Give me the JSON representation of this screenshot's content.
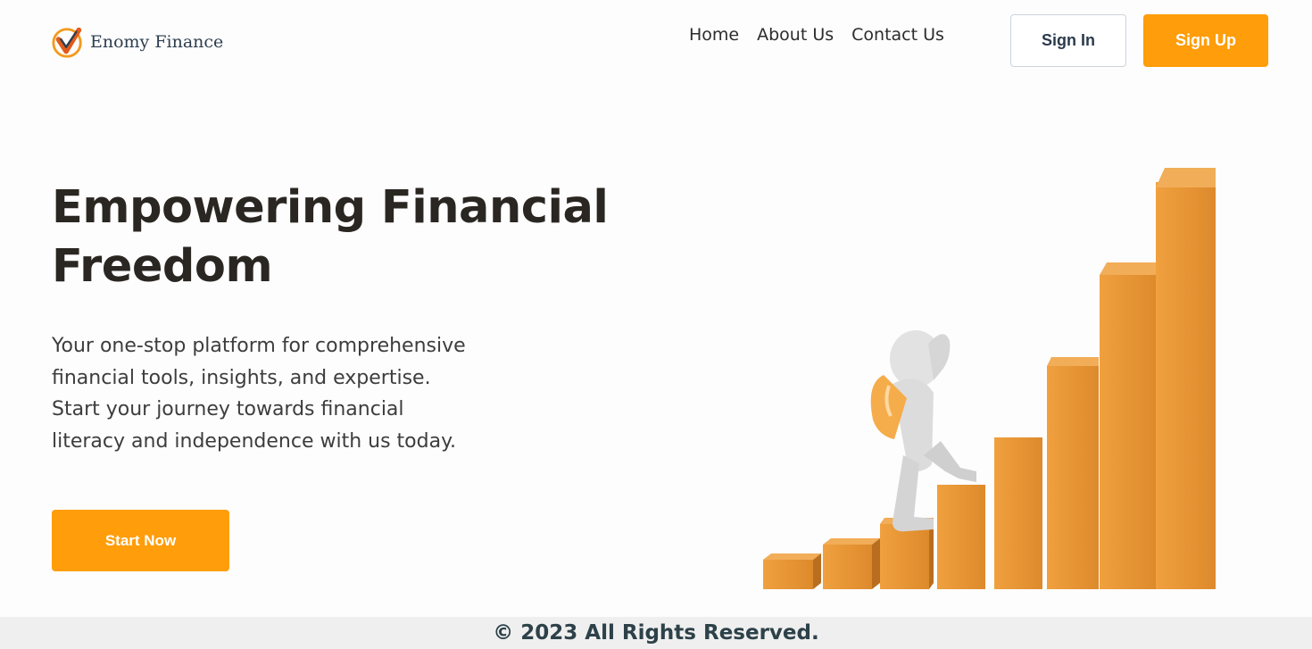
{
  "brand": {
    "name": "Enomy Finance"
  },
  "nav": {
    "items": [
      "Home",
      "About Us",
      "Contact Us"
    ]
  },
  "auth": {
    "sign_in": "Sign In",
    "sign_up": "Sign Up"
  },
  "hero": {
    "title_line1": "Empowering Financial",
    "title_line2": "Freedom",
    "subtitle_lines": [
      "Your one-stop platform for comprehensive",
      "financial tools, insights, and expertise.",
      "Start your journey towards financial",
      "literacy and independence with us today."
    ],
    "cta": "Start Now"
  },
  "illustration": {
    "name": "figure-climbing-bar-chart-stairs"
  },
  "footer": {
    "text": "© 2023 All Rights Reserved."
  },
  "colors": {
    "accent": "#ff9d0a",
    "bar": "#e6902f",
    "heading": "#2a2622"
  }
}
